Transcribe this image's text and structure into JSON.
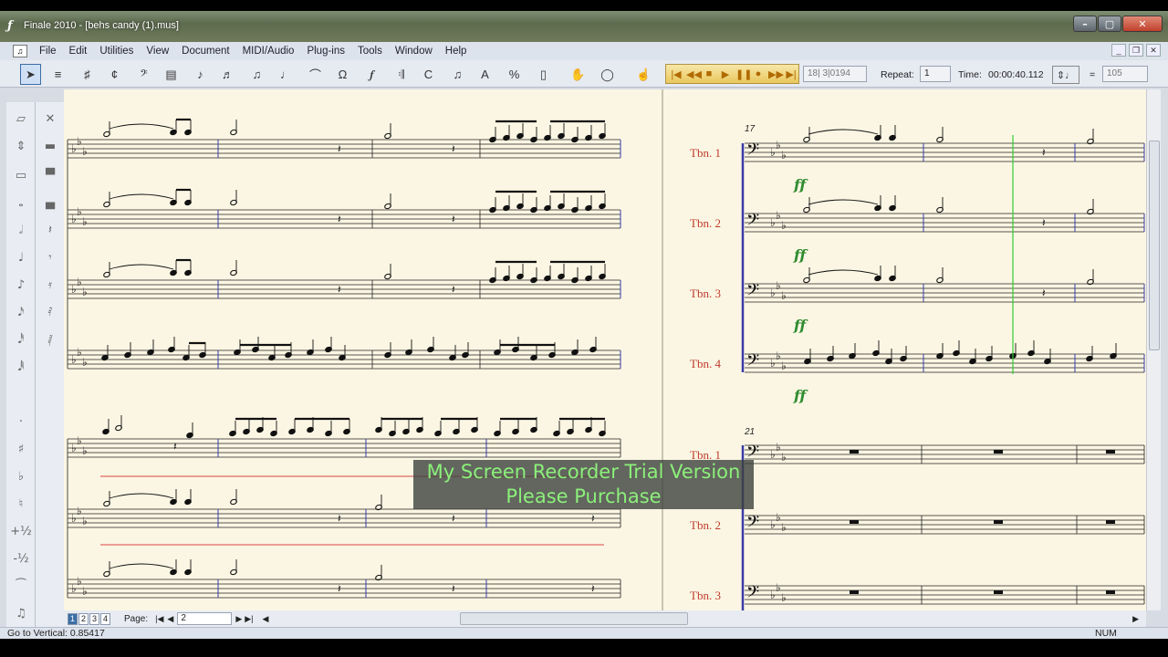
{
  "window": {
    "title": "Finale 2010 - [behs candy (1).mus]"
  },
  "menu": [
    "File",
    "Edit",
    "Utilities",
    "View",
    "Document",
    "MIDI/Audio",
    "Plug-ins",
    "Tools",
    "Window",
    "Help"
  ],
  "toolbar": {
    "measure_readout": "18| 3|0194",
    "repeat_label": "Repeat:",
    "repeat_value": "1",
    "time_label": "Time:",
    "time_value": "00:00:40.112",
    "tempo_equals": "=",
    "tempo_value": "105"
  },
  "score": {
    "instruments": [
      "Tbn. 1",
      "Tbn. 2",
      "Tbn. 3",
      "Tbn. 4"
    ],
    "system_bottom_instruments": [
      "Tbn. 1",
      "Tbn. 2",
      "Tbn. 3"
    ],
    "measure_numbers": [
      "17",
      "21"
    ],
    "dynamic": "ff"
  },
  "navigation": {
    "pages": [
      "1",
      "2",
      "3",
      "4"
    ],
    "current_page_index": 0,
    "page_label": "Page:",
    "page_value": "2"
  },
  "status": {
    "left": "Go to Vertical: 0.85417",
    "right": "NUM"
  },
  "watermark": {
    "line1": "My Screen Recorder Trial Version",
    "line2": "Please Purchase"
  },
  "colors": {
    "staff_label": "#c0392b",
    "dynamic": "#2e8b2e",
    "playback_line": "#33cc33",
    "barline_blue": "#3a3aa8"
  }
}
